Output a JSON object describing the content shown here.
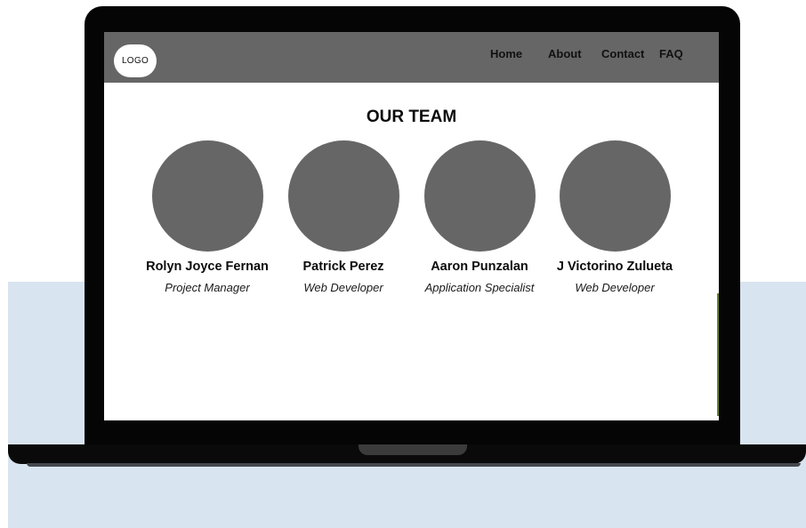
{
  "logo": {
    "label": "LOGO"
  },
  "nav": {
    "items": [
      {
        "label": "Home"
      },
      {
        "label": "About"
      },
      {
        "label": "Contact"
      },
      {
        "label": "FAQ"
      }
    ]
  },
  "team": {
    "title": "OUR TEAM",
    "members": [
      {
        "name": "Rolyn Joyce Fernan",
        "role": "Project Manager"
      },
      {
        "name": "Patrick Perez",
        "role": "Web Developer"
      },
      {
        "name": "Aaron Punzalan",
        "role": "Application Specialist"
      },
      {
        "name": "J Victorino Zulueta",
        "role": "Web Developer"
      }
    ]
  },
  "colors": {
    "navbar": "#666666",
    "avatar": "#666666",
    "backdrop": "#d8e4ef",
    "laptop": "#050505"
  }
}
